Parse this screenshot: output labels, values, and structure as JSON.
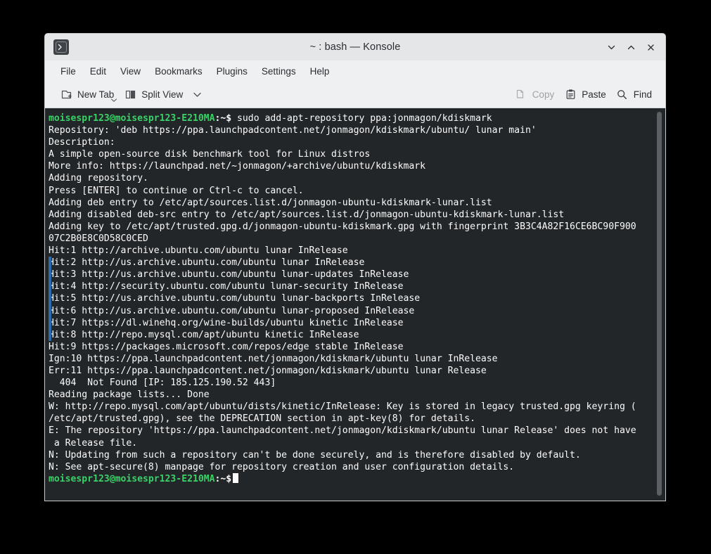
{
  "window": {
    "title": "~ : bash — Konsole",
    "app_icon": "konsole-icon",
    "controls": [
      {
        "name": "minimize-button",
        "glyph": "chevron-down"
      },
      {
        "name": "maximize-button",
        "glyph": "chevron-up"
      },
      {
        "name": "close-button",
        "glyph": "cross"
      }
    ]
  },
  "menubar": {
    "items": [
      {
        "label": "File"
      },
      {
        "label": "Edit"
      },
      {
        "label": "View"
      },
      {
        "label": "Bookmarks"
      },
      {
        "label": "Plugins"
      },
      {
        "label": "Settings"
      },
      {
        "label": "Help"
      }
    ]
  },
  "toolbar": {
    "new_tab_label": "New Tab",
    "split_view_label": "Split View",
    "copy_label": "Copy",
    "paste_label": "Paste",
    "find_label": "Find",
    "copy_disabled": true
  },
  "colors": {
    "terminal_background": "#232629",
    "terminal_foreground": "#fcfcfc",
    "prompt_green": "#3bd169",
    "window_chrome": "#eff0f1",
    "titlebar": "#e4e6e7",
    "gutter_marker": "#2a6ba8",
    "scrollbar_thumb": "#5c6065"
  },
  "terminal": {
    "prompt_user_host": "moisespr123@moisespr123-E210MA",
    "prompt_path": ":~$",
    "command": " sudo add-apt-repository ppa:jonmagon/kdiskmark",
    "lines": [
      {
        "type": "prompt",
        "command": " sudo add-apt-repository ppa:jonmagon/kdiskmark"
      },
      {
        "type": "text",
        "text": "Repository: 'deb https://ppa.launchpadcontent.net/jonmagon/kdiskmark/ubuntu/ lunar main'"
      },
      {
        "type": "text",
        "text": "Description:"
      },
      {
        "type": "text",
        "text": "A simple open-source disk benchmark tool for Linux distros"
      },
      {
        "type": "text",
        "text": "More info: https://launchpad.net/~jonmagon/+archive/ubuntu/kdiskmark"
      },
      {
        "type": "text",
        "text": "Adding repository."
      },
      {
        "type": "text",
        "text": "Press [ENTER] to continue or Ctrl-c to cancel."
      },
      {
        "type": "text",
        "text": "Adding deb entry to /etc/apt/sources.list.d/jonmagon-ubuntu-kdiskmark-lunar.list"
      },
      {
        "type": "text",
        "text": "Adding disabled deb-src entry to /etc/apt/sources.list.d/jonmagon-ubuntu-kdiskmark-lunar.list"
      },
      {
        "type": "text",
        "text": "Adding key to /etc/apt/trusted.gpg.d/jonmagon-ubuntu-kdiskmark.gpg with fingerprint 3B3C4A82F16CE6BC90F900"
      },
      {
        "type": "text",
        "text": "07C2B0E8C0D58C0CED"
      },
      {
        "type": "text",
        "text": "Hit:1 http://archive.ubuntu.com/ubuntu lunar InRelease"
      },
      {
        "type": "text",
        "text": "Hit:2 http://us.archive.ubuntu.com/ubuntu lunar InRelease",
        "marked": true
      },
      {
        "type": "text",
        "text": "Hit:3 http://us.archive.ubuntu.com/ubuntu lunar-updates InRelease",
        "marked": true
      },
      {
        "type": "text",
        "text": "Hit:4 http://security.ubuntu.com/ubuntu lunar-security InRelease",
        "marked": true
      },
      {
        "type": "text",
        "text": "Hit:5 http://us.archive.ubuntu.com/ubuntu lunar-backports InRelease",
        "marked": true
      },
      {
        "type": "text",
        "text": "Hit:6 http://us.archive.ubuntu.com/ubuntu lunar-proposed InRelease",
        "marked": true
      },
      {
        "type": "text",
        "text": "Hit:7 https://dl.winehq.org/wine-builds/ubuntu kinetic InRelease",
        "marked": true
      },
      {
        "type": "text",
        "text": "Hit:8 http://repo.mysql.com/apt/ubuntu kinetic InRelease",
        "marked": true
      },
      {
        "type": "text",
        "text": "Hit:9 https://packages.microsoft.com/repos/edge stable InRelease"
      },
      {
        "type": "text",
        "text": "Ign:10 https://ppa.launchpadcontent.net/jonmagon/kdiskmark/ubuntu lunar InRelease"
      },
      {
        "type": "text",
        "text": "Err:11 https://ppa.launchpadcontent.net/jonmagon/kdiskmark/ubuntu lunar Release"
      },
      {
        "type": "text",
        "text": "  404  Not Found [IP: 185.125.190.52 443]"
      },
      {
        "type": "text",
        "text": "Reading package lists... Done"
      },
      {
        "type": "text",
        "text": "W: http://repo.mysql.com/apt/ubuntu/dists/kinetic/InRelease: Key is stored in legacy trusted.gpg keyring ("
      },
      {
        "type": "text",
        "text": "/etc/apt/trusted.gpg), see the DEPRECATION section in apt-key(8) for details."
      },
      {
        "type": "text",
        "text": "E: The repository 'https://ppa.launchpadcontent.net/jonmagon/kdiskmark/ubuntu lunar Release' does not have"
      },
      {
        "type": "text",
        "text": " a Release file."
      },
      {
        "type": "text",
        "text": "N: Updating from such a repository can't be done securely, and is therefore disabled by default."
      },
      {
        "type": "text",
        "text": "N: See apt-secure(8) manpage for repository creation and user configuration details."
      },
      {
        "type": "prompt-cursor",
        "command": ""
      }
    ]
  }
}
